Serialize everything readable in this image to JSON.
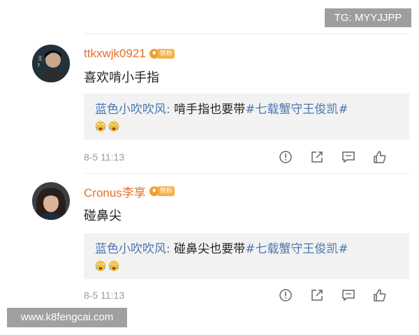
{
  "top_badge": "TG: MYYJJPP",
  "watermark": "www.k8fengcai.com",
  "comments": [
    {
      "username": "ttkxwjk0921",
      "badge_label": "铁粉",
      "text": "喜欢啃小手指",
      "reply": {
        "author": "蓝色小吹吹风",
        "colon": ": ",
        "body": "啃手指也要带",
        "tag": "#七载蟹守王俊凯#",
        "emoji_count": 2
      },
      "timestamp": "8-5 11:13"
    },
    {
      "username": "Cronus李享",
      "badge_label": "铁粉",
      "text": "碰鼻尖",
      "reply": {
        "author": "蓝色小吹吹风",
        "colon": ": ",
        "body": "碰鼻尖也要带",
        "tag": "#七载蟹守王俊凯#",
        "emoji_count": 2
      },
      "timestamp": "8-5 11:13"
    }
  ],
  "icons": {
    "actions": [
      "report-icon",
      "repost-icon",
      "comment-icon",
      "like-icon"
    ],
    "emoji": "crying-face-emoji-icon"
  },
  "colors": {
    "username": "#e3722c",
    "reply_link": "#4a78b0",
    "badge": "#f39d2a",
    "reply_bg": "#f2f2f2",
    "timestamp": "#9a9a9a"
  }
}
